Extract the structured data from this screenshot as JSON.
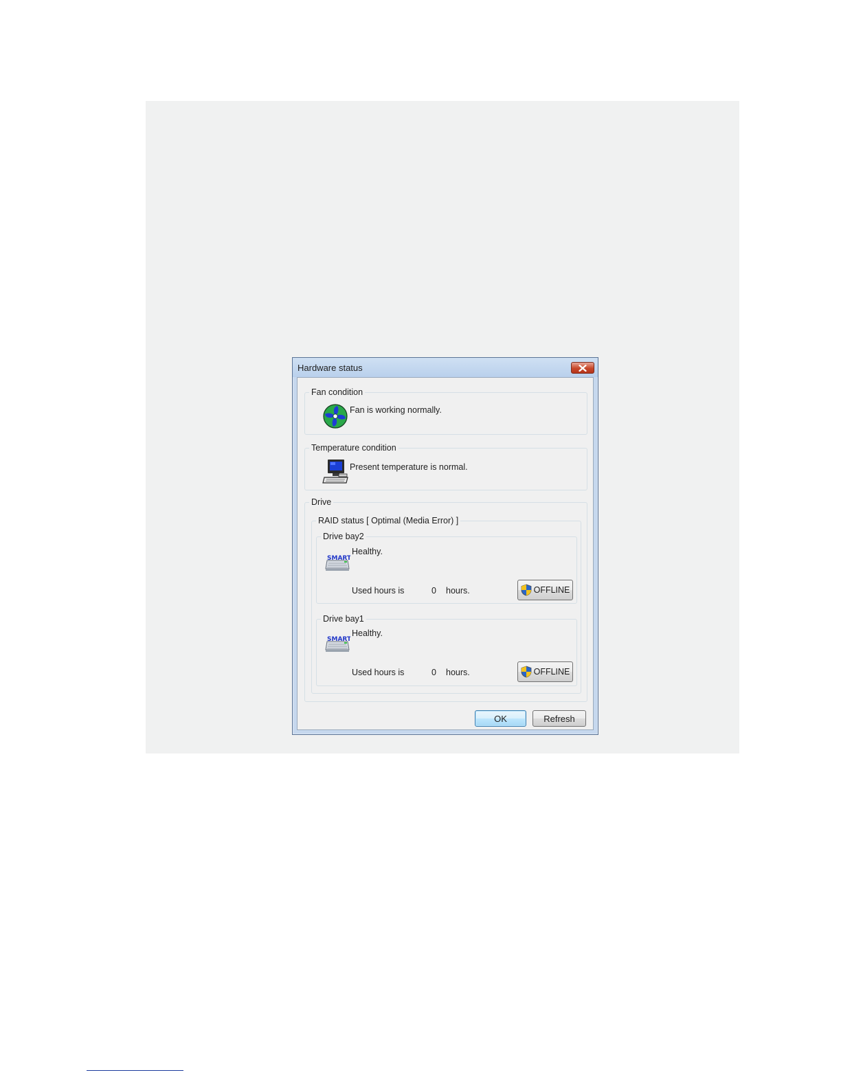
{
  "dialog": {
    "title": "Hardware status",
    "close_label": "×"
  },
  "fan": {
    "group_label": "Fan condition",
    "message": "Fan is working normally.",
    "icon": "fan-icon"
  },
  "temperature": {
    "group_label": "Temperature condition",
    "message": "Present temperature is normal.",
    "icon": "computer-icon"
  },
  "drive": {
    "group_label": "Drive",
    "raid_status_label": "RAID status [ Optimal (Media Error) ]",
    "bays": [
      {
        "label": "Drive bay2",
        "status": "Healthy.",
        "used_hours_label": "Used hours is",
        "used_hours_value": "0",
        "hours_unit": "hours.",
        "offline_label": "OFFLINE",
        "icon": "smart-drive-icon"
      },
      {
        "label": "Drive bay1",
        "status": "Healthy.",
        "used_hours_label": "Used hours is",
        "used_hours_value": "0",
        "hours_unit": "hours.",
        "offline_label": "OFFLINE",
        "icon": "smart-drive-icon"
      }
    ]
  },
  "buttons": {
    "ok_label": "OK",
    "refresh_label": "Refresh"
  },
  "colors": {
    "backdrop": "#f0f1f1",
    "titlebar": "#c6d8ee",
    "close_button": "#c7472a",
    "default_button_border": "#3c7fb1"
  }
}
